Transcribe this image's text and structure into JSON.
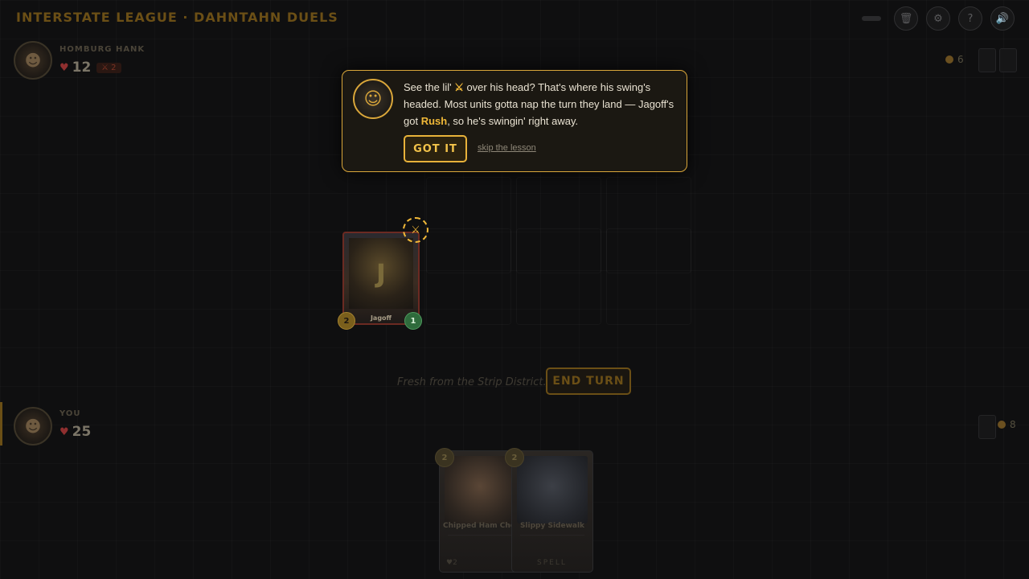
{
  "app": {
    "title": "INTERSTATE LEAGUE · DAHNTAHN DUELS"
  },
  "top_bar": {
    "icons": [
      "trash-icon",
      "gear-icon",
      "help-icon",
      "speaker-icon"
    ],
    "icon_glyphs": [
      "🗑",
      "⚙",
      "?",
      "🔊"
    ]
  },
  "opponent": {
    "name": "HOMBURG HANK",
    "health": "12",
    "attack_badge": "⚔ 2",
    "coins": "6"
  },
  "player": {
    "name": "YOU",
    "health": "25",
    "coins": "8"
  },
  "board": {
    "unit": {
      "name": "Jagoff",
      "cost": "2",
      "power": "1",
      "art_glyph": "J",
      "intent_icon": "⚔"
    }
  },
  "turn": {
    "flavor_text": "Fresh from the Strip District.",
    "end_turn_label": "END TURN"
  },
  "hand": [
    {
      "title": "Chipped Ham Chomper",
      "cost": "2",
      "footer": "♥2"
    },
    {
      "title": "Slippy Sidewalk",
      "cost": "2",
      "footer": "SPELL"
    }
  ],
  "tutorial": {
    "text_part1": "See the lil' ",
    "inline_icon": "⚔",
    "text_part2": " over his head? That's where his swing's headed. Most units gotta nap the turn they land — Jagoff's got ",
    "keyword": "Rush",
    "text_part3": ", so he's swingin' right away.",
    "got_it_label": "GOT IT",
    "skip_label": "skip the lesson"
  },
  "colors": {
    "accent": "#f0b838",
    "panel_border": "#d9a63a",
    "attack_red": "#8f2f2f",
    "power_green": "#2f6b3c"
  }
}
